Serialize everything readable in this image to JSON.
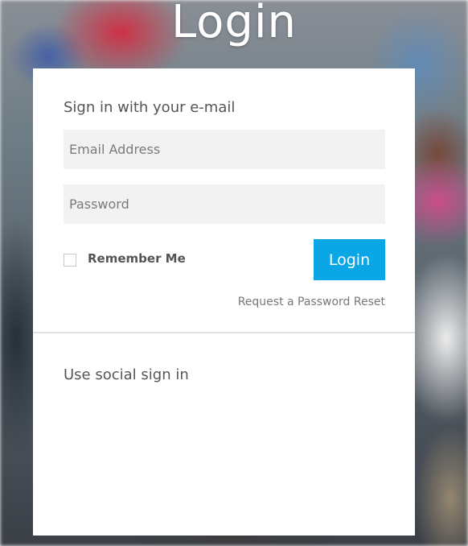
{
  "page": {
    "title": "Login"
  },
  "email_signin": {
    "heading": "Sign in with your e-mail",
    "email_placeholder": "Email Address",
    "password_placeholder": "Password",
    "remember_label": "Remember Me",
    "remember_checked": false,
    "login_button": "Login",
    "reset_link": "Request a Password Reset"
  },
  "social_signin": {
    "heading": "Use social sign in"
  },
  "colors": {
    "accent": "#0aa6e6",
    "card": "#ffffff",
    "input_bg": "#f2f2f2",
    "text": "#555555"
  }
}
